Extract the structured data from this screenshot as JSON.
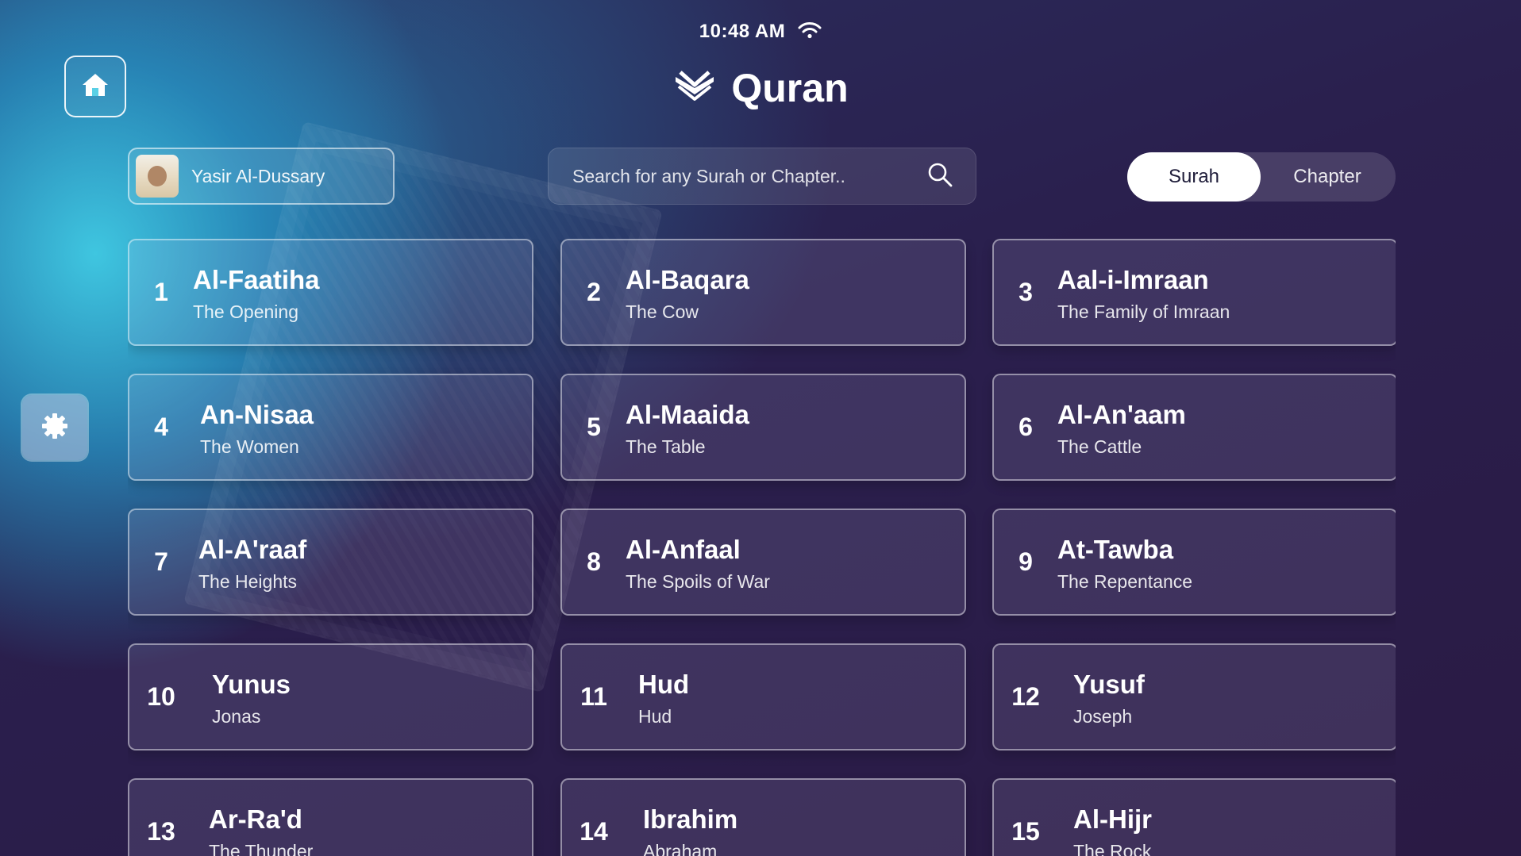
{
  "status": {
    "time": "10:48 AM"
  },
  "header": {
    "title": "Quran"
  },
  "reciter": {
    "name": "Yasir Al-Dussary"
  },
  "search": {
    "placeholder": "Search for any Surah or Chapter.."
  },
  "toggle": {
    "options": [
      "Surah",
      "Chapter"
    ],
    "selected": "Surah"
  },
  "surahs": [
    {
      "number": "1",
      "name": "Al-Faatiha",
      "meaning": "The Opening"
    },
    {
      "number": "2",
      "name": "Al-Baqara",
      "meaning": "The Cow"
    },
    {
      "number": "3",
      "name": "Aal-i-Imraan",
      "meaning": "The Family of Imraan"
    },
    {
      "number": "4",
      "name": "An-Nisaa",
      "meaning": "The Women"
    },
    {
      "number": "5",
      "name": "Al-Maaida",
      "meaning": "The Table"
    },
    {
      "number": "6",
      "name": "Al-An'aam",
      "meaning": "The Cattle"
    },
    {
      "number": "7",
      "name": "Al-A'raaf",
      "meaning": "The Heights"
    },
    {
      "number": "8",
      "name": "Al-Anfaal",
      "meaning": "The Spoils of War"
    },
    {
      "number": "9",
      "name": "At-Tawba",
      "meaning": "The Repentance"
    },
    {
      "number": "10",
      "name": "Yunus",
      "meaning": "Jonas"
    },
    {
      "number": "11",
      "name": "Hud",
      "meaning": "Hud"
    },
    {
      "number": "12",
      "name": "Yusuf",
      "meaning": "Joseph"
    },
    {
      "number": "13",
      "name": "Ar-Ra'd",
      "meaning": "The Thunder"
    },
    {
      "number": "14",
      "name": "Ibrahim",
      "meaning": "Abraham"
    },
    {
      "number": "15",
      "name": "Al-Hijr",
      "meaning": "The Rock"
    }
  ],
  "icons": {
    "home": "home-icon",
    "settings": "gear-icon",
    "search": "search-icon",
    "wifi": "wifi-icon",
    "logo": "quran-book-icon"
  }
}
